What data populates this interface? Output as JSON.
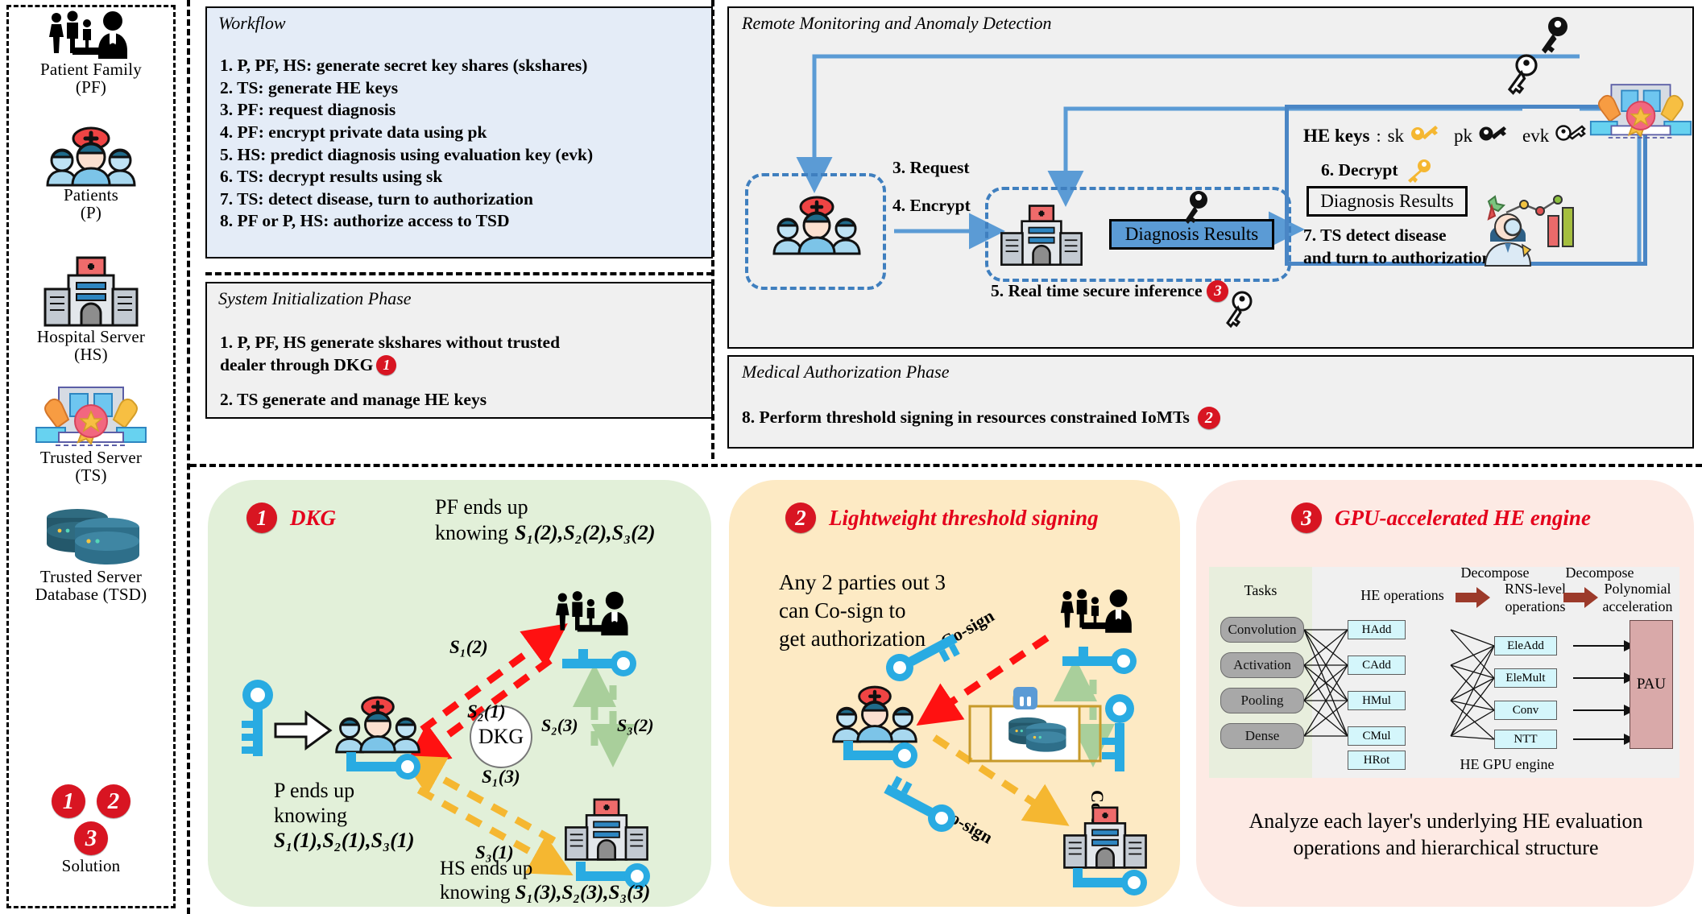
{
  "legend": {
    "items": [
      {
        "name": "patient-family",
        "icon": "family-with-doctor-icon",
        "label_1": "Patient Family",
        "label_2": "(PF)"
      },
      {
        "name": "patients",
        "icon": "patients-group-icon",
        "label_1": "Patients",
        "label_2": "(P)"
      },
      {
        "name": "hospital-server",
        "icon": "hospital-building-icon",
        "label_1": "Hospital  Server",
        "label_2": "(HS)"
      },
      {
        "name": "trusted-server",
        "icon": "trusted-server-award-icon",
        "label_1": "Trusted Server",
        "label_2": "(TS)"
      },
      {
        "name": "trusted-server-database",
        "icon": "database-icon",
        "label_1": "Trusted Server",
        "label_2": "Database (TSD)"
      }
    ],
    "solution": {
      "badges": [
        "1",
        "2",
        "3"
      ],
      "label": "Solution"
    }
  },
  "workflow": {
    "title": "Workflow",
    "steps": [
      "1. P, PF, HS: generate secret key shares (skshares)",
      "2. TS: generate HE keys",
      "3. PF: request diagnosis",
      "4. PF: encrypt private data using pk",
      "5. HS: predict diagnosis using evaluation key (evk)",
      "6. TS: decrypt results using sk",
      "7. TS: detect disease, turn to authorization",
      "8. PF or P, HS: authorize access to TSD"
    ]
  },
  "system_init": {
    "title": "System Initialization  Phase",
    "step1_a": "1. P, PF, HS  generate skshares without trusted",
    "step1_b": "dealer through DKG",
    "step1_badge": "1",
    "step2": "2. TS generate and manage HE keys"
  },
  "remote_monitoring": {
    "title": "Remote Monitoring and Anomaly Detection",
    "request_label": "3. Request",
    "encrypt_label": "4. Encrypt",
    "inference_label": "5.  Real time secure inference",
    "inference_badge": "3",
    "diagnosis_results_encrypted": "Diagnosis Results",
    "he_keys_label": "HE keys",
    "he_keys_colon": ":",
    "key_sk": "sk",
    "key_pk": "pk",
    "key_evk": "evk",
    "decrypt_label": "6. Decrypt",
    "diagnosis_results_plain": "Diagnosis Results",
    "detect_line1": "7. TS detect disease",
    "detect_line2": "and turn to authorization"
  },
  "medical_auth": {
    "title": "Medical Authorization Phase",
    "step8": "8. Perform threshold signing in  resources constrained IoMTs",
    "step8_badge": "2"
  },
  "dkg_card": {
    "badge": "1",
    "title": "DKG",
    "pf_line1": "PF ends up",
    "pf_line2": "knowing",
    "pf_shares": "S₁(2),S₂(2),S₃(2)",
    "p_line1": "P ends up",
    "p_line2": "knowing",
    "p_shares": "S₁(1),S₂(1),S₃(1)",
    "hs_line1": "HS ends up",
    "hs_line2": "knowing",
    "hs_shares": "S₁(3),S₂(3),S₃(3)",
    "center_label": "DKG",
    "edge_s1_2": "S₁(2)",
    "edge_s2_1": "S₂(1)",
    "edge_s2_3": "S₂(3)",
    "edge_s3_2": "S₃(2)",
    "edge_s1_3": "S₁(3)",
    "edge_s3_1": "S₃(1)",
    "bg": "#e2f0d9"
  },
  "signing_card": {
    "badge": "2",
    "title": "Lightweight threshold signing",
    "desc_1": "Any 2 parties out 3",
    "desc_2": " can Co-sign to",
    "desc_3": "get  authorization",
    "cosign_top": "Co-sign",
    "cosign_bottom": "Co-sign",
    "cosign_right": "Co-sign",
    "bg": "#fdeac4"
  },
  "gpu_card": {
    "badge": "3",
    "title": "GPU-accelerated HE engine",
    "engine": {
      "tasks_header": "Tasks",
      "tasks": [
        "Convolution",
        "Activation",
        "Pooling",
        "Dense"
      ],
      "he_ops_header": "HE operations",
      "he_ops": [
        "HAdd",
        "CAdd",
        "HMul",
        "CMul",
        "HRot"
      ],
      "rns_header_1": "RNS-level",
      "rns_header_2": "operations",
      "rns_ops": [
        "EleAdd",
        "EleMult",
        "Conv",
        "NTT"
      ],
      "poly_header_1": "Polynomial",
      "poly_header_2": "acceleration",
      "pau": "PAU",
      "decompose_1": "Decompose",
      "decompose_2": "Decompose",
      "engine_label": "HE GPU engine"
    },
    "caption_1": "Analyze each layer's underlying HE evaluation",
    "caption_2": "operations and hierarchical structure",
    "bg": "#fdeae4"
  },
  "colors": {
    "accent_red": "#d81522",
    "blue_flow": "#5b9bd5",
    "panel_bg": "#f0f0f0",
    "workflow_bg": "#e4ecf7"
  }
}
